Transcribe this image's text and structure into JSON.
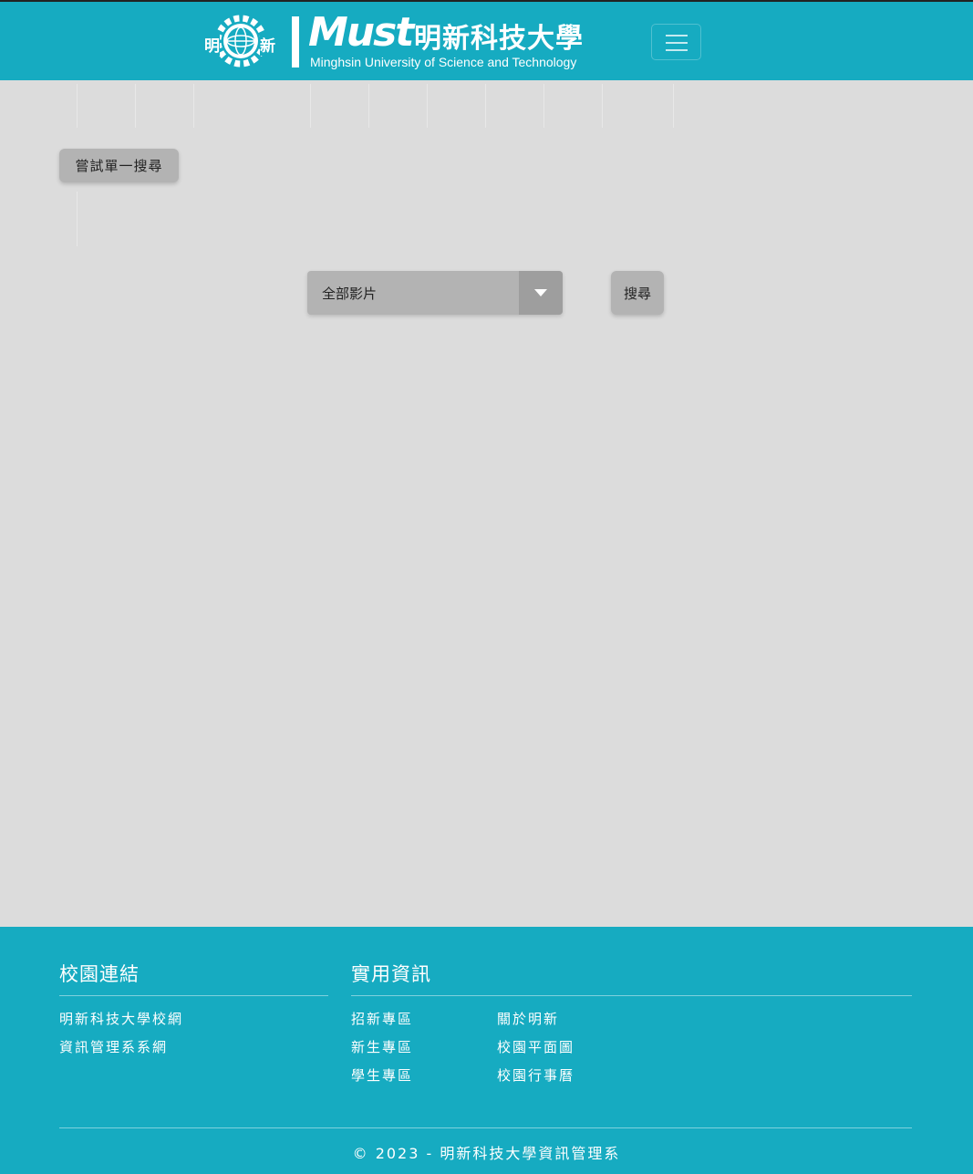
{
  "header": {
    "logo": {
      "badge_left": "明",
      "badge_right": "新",
      "brand": "Must",
      "name_cn": "明新科技大學",
      "name_en": "Minghsin University of Science and Technology"
    },
    "menu_icon": "hamburger-icon"
  },
  "main": {
    "single_search_label": "嘗試單一搜尋",
    "category_select": {
      "selected": "全部影片",
      "icon": "caret-down-icon"
    },
    "search_label": "搜尋"
  },
  "footer": {
    "campus_links": {
      "title": "校園連結",
      "items": [
        "明新科技大學校網",
        "資訊管理系系網"
      ]
    },
    "useful_info": {
      "title": "實用資訊",
      "col1": [
        "招新專區",
        "新生專區",
        "學生專區"
      ],
      "col2": [
        "關於明新",
        "校園平面圖",
        "校園行事曆"
      ]
    },
    "copyright": "© 2023 - 明新科技大學資訊管理系"
  },
  "colors": {
    "brand_teal": "#16abc1",
    "page_bg": "#dcdcdc",
    "control_gray": "#b3b3b3"
  }
}
